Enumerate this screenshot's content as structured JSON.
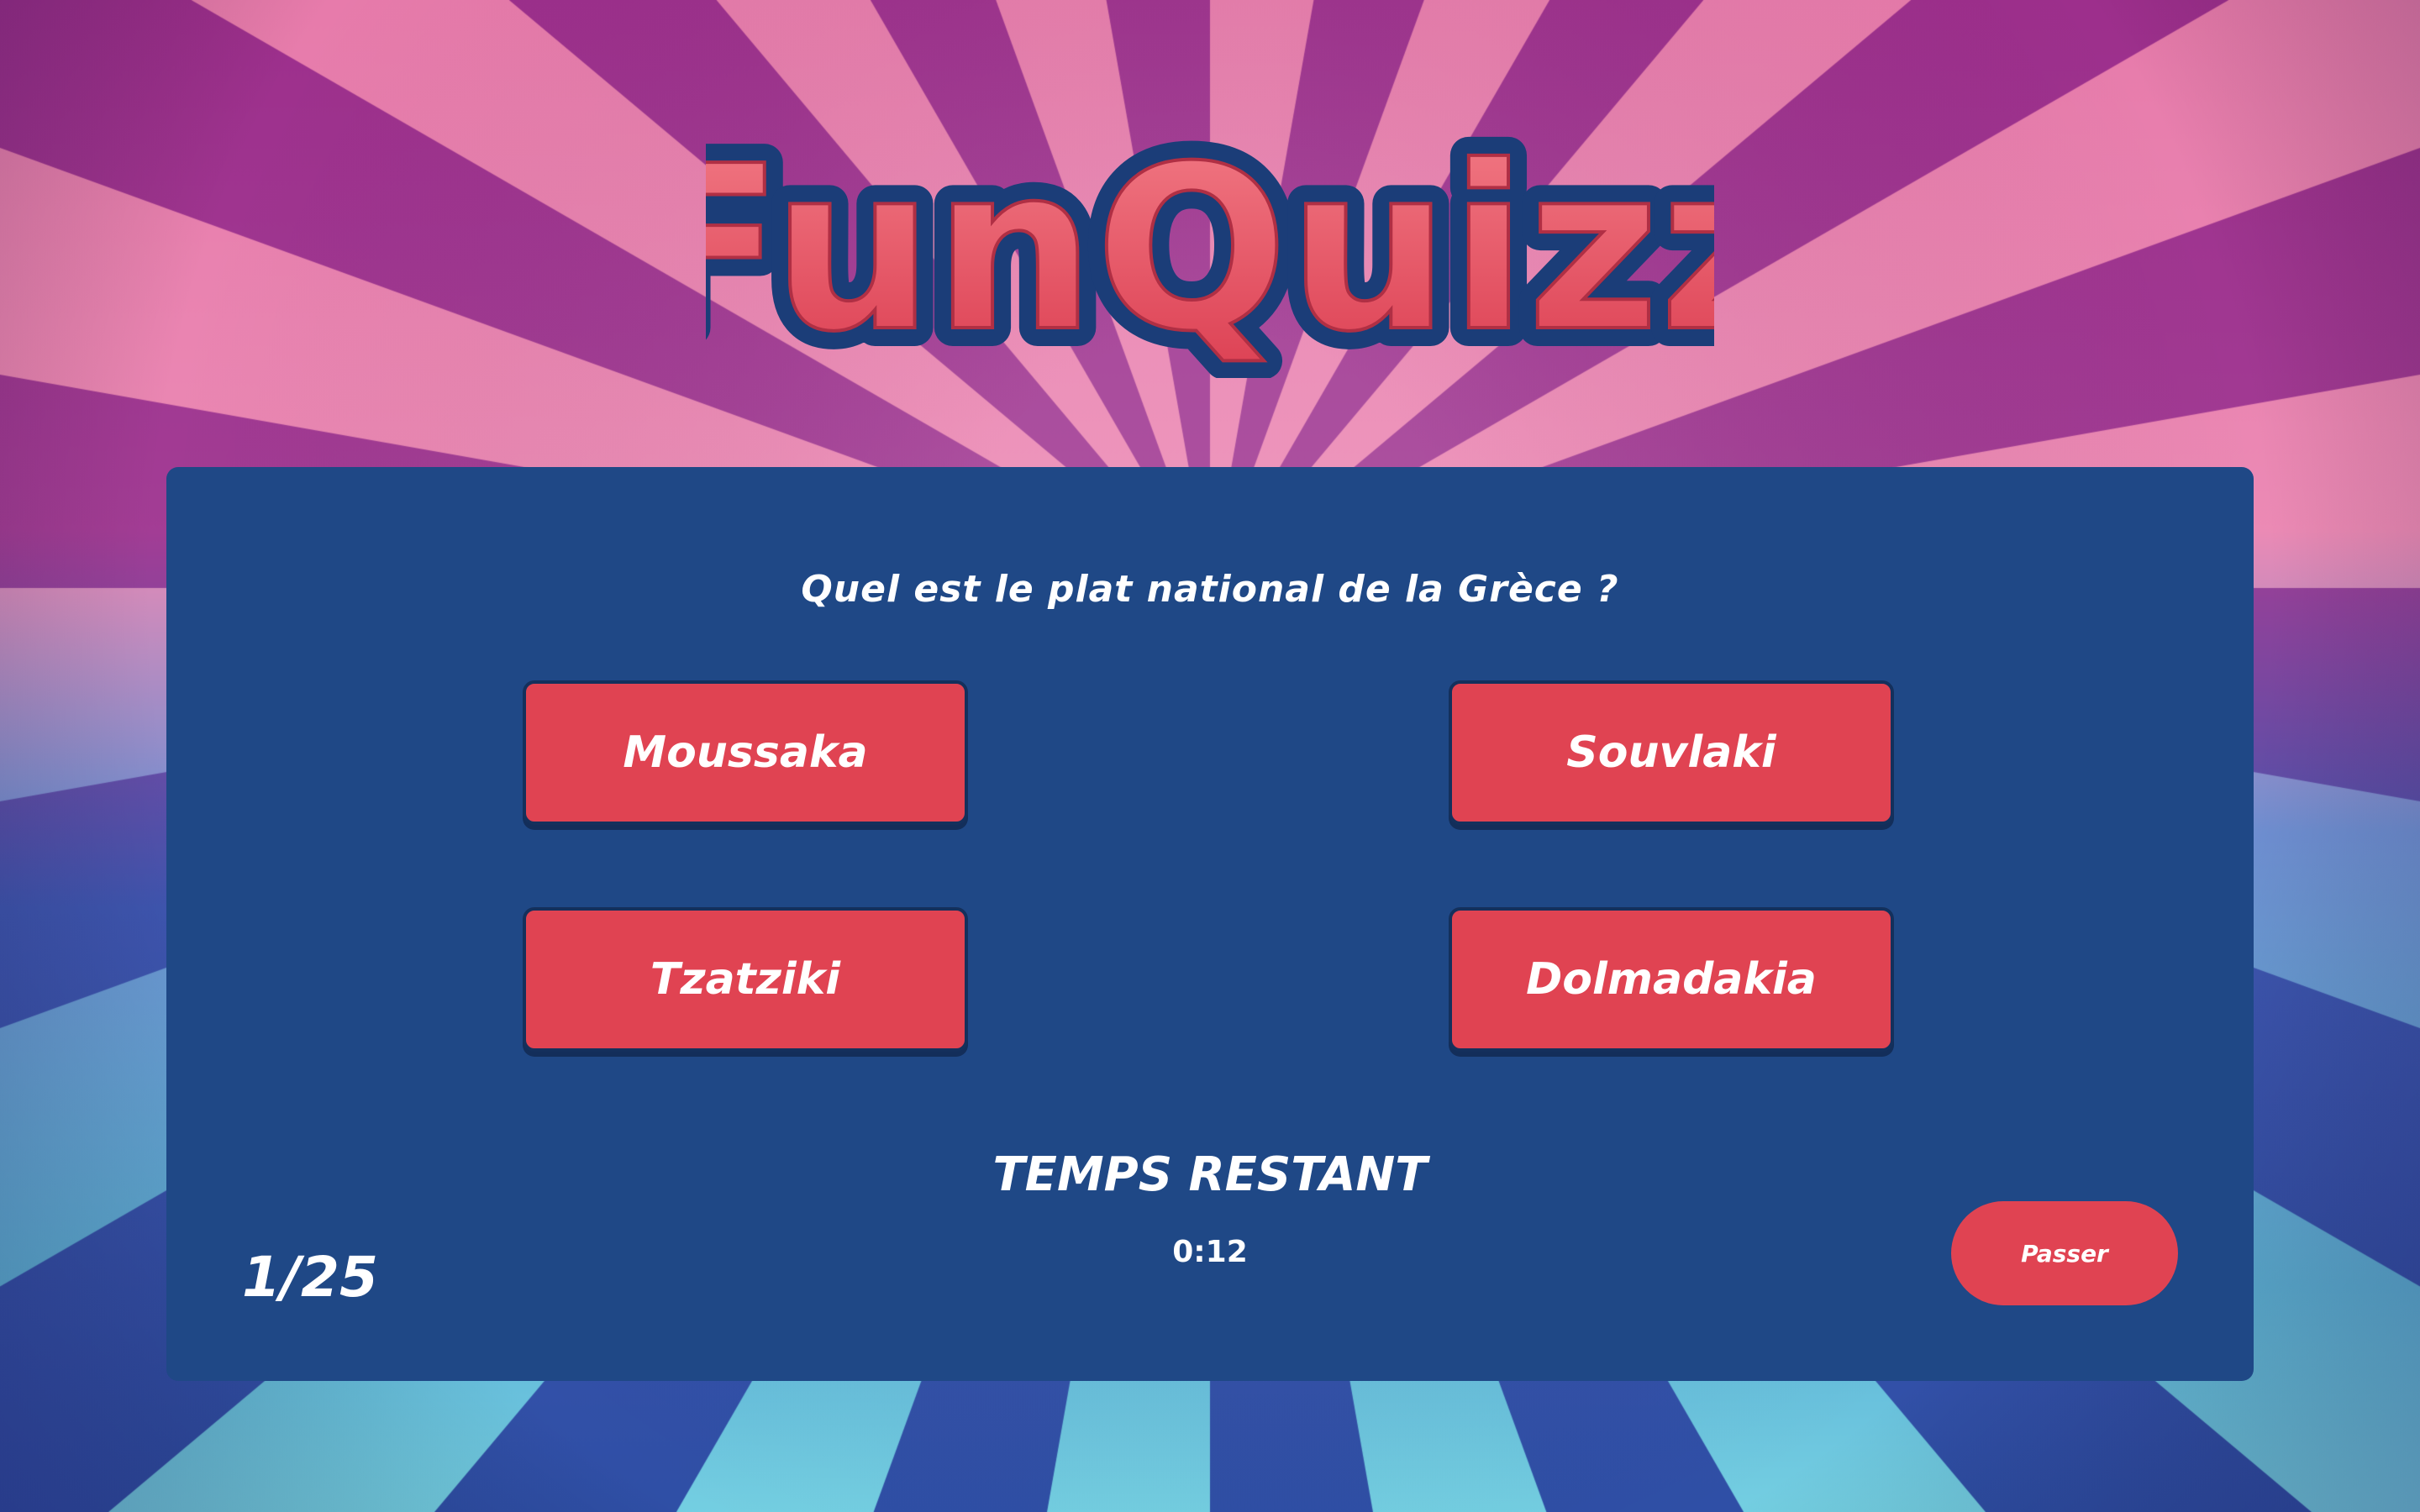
{
  "app": {
    "logo_text": "FunQuizz"
  },
  "quiz": {
    "question": "Quel est le plat national de la Grèce ?",
    "answers": [
      {
        "label": "Moussaka"
      },
      {
        "label": "Souvlaki"
      },
      {
        "label": "Tzatziki"
      },
      {
        "label": "Dolmadakia"
      }
    ],
    "timer_label": "TEMPS RESTANT",
    "timer_value": "0:12",
    "progress": "1/25",
    "skip_label": "Passer"
  },
  "colors": {
    "panel": "#1f4886",
    "accent": "#e04352",
    "outline": "#14305c",
    "ray_pink": "#e46fa3",
    "ray_purple": "#8f2f8f",
    "ray_blue": "#3d6fbf",
    "ray_cyan": "#6cc6dc"
  }
}
